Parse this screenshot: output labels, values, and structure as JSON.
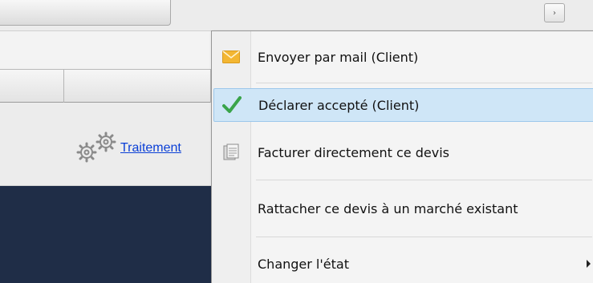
{
  "background": {
    "scroll_arrow_glyph": "›",
    "traitement_link": "Traitement"
  },
  "context_menu": {
    "items": [
      {
        "label": "Envoyer par mail (Client)",
        "icon": "envelope-icon"
      },
      {
        "label": "Déclarer accepté (Client)",
        "icon": "checkmark-icon",
        "highlighted": true
      },
      {
        "label": "Facturer directement ce devis",
        "icon": "document-icon"
      },
      {
        "label": "Rattacher ce devis à un marché existant",
        "icon": ""
      },
      {
        "label": "Changer l'état",
        "icon": "",
        "has_submenu": true
      }
    ]
  },
  "colors": {
    "highlight": "#cfe6f7",
    "checkmark": "#3aa44a",
    "envelope": "#f3b632",
    "link": "#0a3fd6",
    "dark_panel": "#1f2d47"
  }
}
